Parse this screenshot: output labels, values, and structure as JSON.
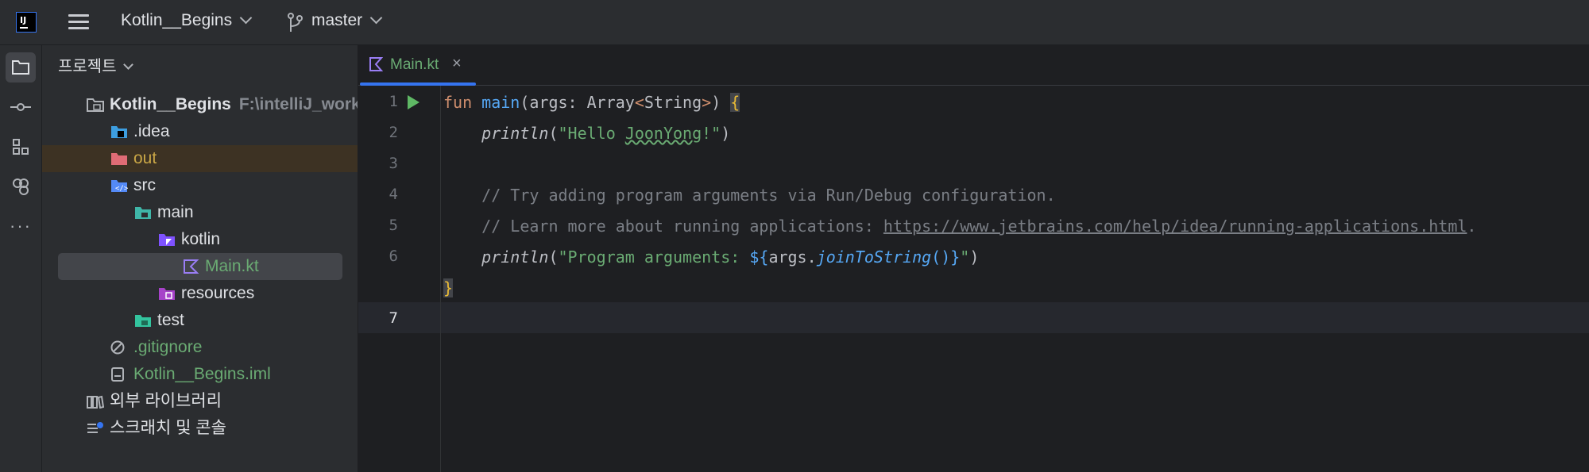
{
  "titlebar": {
    "project_name": "Kotlin__Begins",
    "branch": "master"
  },
  "panel": {
    "title": "프로젝트",
    "tree": [
      {
        "label": "Kotlin__Begins",
        "hint": "F:\\intelliJ_work"
      },
      {
        "label": ".idea"
      },
      {
        "label": "out"
      },
      {
        "label": "src"
      },
      {
        "label": "main"
      },
      {
        "label": "kotlin"
      },
      {
        "label": "Main.kt"
      },
      {
        "label": "resources"
      },
      {
        "label": "test"
      },
      {
        "label": ".gitignore"
      },
      {
        "label": "Kotlin__Begins.iml"
      },
      {
        "label": "외부 라이브러리"
      },
      {
        "label": "스크래치 및 콘솔"
      }
    ]
  },
  "editor": {
    "tab_label": "Main.kt",
    "line_numbers": [
      "1",
      "2",
      "3",
      "4",
      "5",
      "6",
      "7"
    ],
    "code": {
      "l1_kw": "fun",
      "l1_fn": "main",
      "l1_params": "(args: Array",
      "l1_lt": "<",
      "l1_type": "String",
      "l1_gt": ">",
      "l1_close": ")",
      "l1_brace": "{",
      "l2_fn": "println",
      "l2_open": "(",
      "l2_str_a": "\"Hello ",
      "l2_str_b": "JoonYong",
      "l2_str_c": "!\"",
      "l2_close": ")",
      "l4_comment": "// Try adding program arguments via Run/Debug configuration.",
      "l5_comment": "// Learn more about running applications: ",
      "l5_link": "https://www.jetbrains.com/help/idea/running-applications.html",
      "l5_dot": ".",
      "l6_fn": "println",
      "l6_open": "(",
      "l6_str": "\"Program arguments: ",
      "l6_tmpl_open": "${",
      "l6_args": "args.",
      "l6_call": "joinToString",
      "l6_parens": "()",
      "l6_tmpl_close": "}",
      "l6_str_end": "\"",
      "l6_close": ")",
      "l7_brace": "}"
    }
  },
  "colors": {
    "accent": "#3574f0",
    "run": "#5fb865",
    "string": "#6aab73",
    "keyword": "#cf8e6d",
    "function": "#56a8f5"
  }
}
